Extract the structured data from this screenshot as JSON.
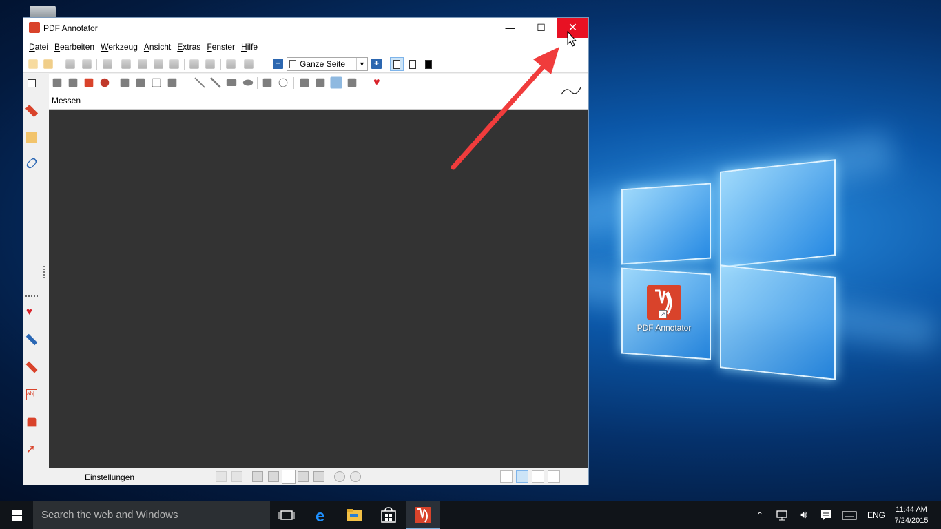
{
  "window": {
    "title": "PDF Annotator",
    "minimize_glyph": "—",
    "maximize_glyph": "☐",
    "close_glyph": "✕"
  },
  "menu": [
    "Datei",
    "Bearbeiten",
    "Werkzeug",
    "Ansicht",
    "Extras",
    "Fenster",
    "Hilfe"
  ],
  "toolbar": {
    "zoom_value": "Ganze Seite",
    "zoom_out_label": "−",
    "zoom_in_label": "+"
  },
  "tool_panel": {
    "section_label": "Messen"
  },
  "statusbar": {
    "settings_label": "Einstellungen"
  },
  "desktop": {
    "icon_label": "PDF Annotator"
  },
  "taskbar": {
    "search_placeholder": "Search the web and Windows",
    "language": "ENG",
    "time": "11:44 AM",
    "date": "7/24/2015"
  },
  "colors": {
    "close_button": "#e81123",
    "app_brand": "#d9432b",
    "annotation_arrow": "#f03c3c",
    "document_background": "#333333"
  }
}
